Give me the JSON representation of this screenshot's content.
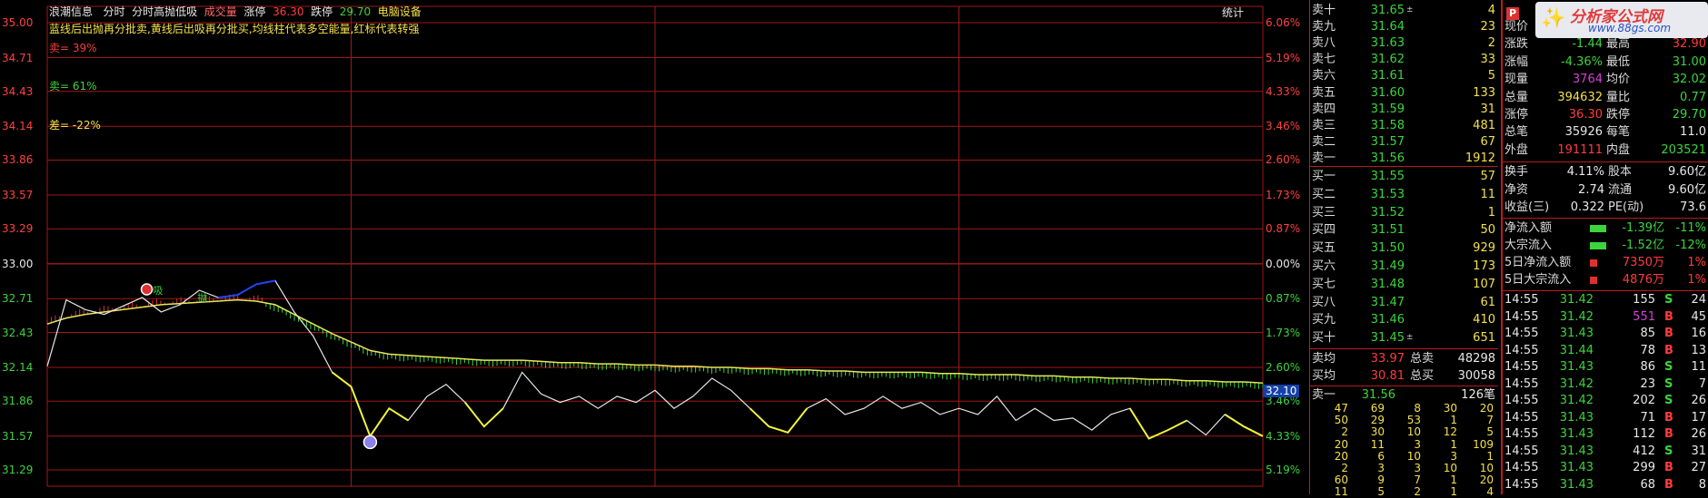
{
  "header": {
    "items": [
      "浪潮信息",
      "分时",
      "分时高抛低吸",
      "成交量",
      "涨停",
      "36.30",
      "跌停",
      "29.70",
      "电脑设备"
    ],
    "desc": "蓝线后出抛再分批卖,黄线后出吸再分批买,均线柱代表多空能量,红标代表转强",
    "sell_pct": "卖= 39%",
    "buy_pct": "卖= 61%",
    "diff_pct": "差= -22%",
    "stats_btn": "统计"
  },
  "price_axis": [
    "35.00",
    "34.71",
    "34.43",
    "34.14",
    "33.86",
    "33.57",
    "33.29",
    "33.00",
    "32.71",
    "32.43",
    "32.14",
    "31.86",
    "31.57",
    "31.29"
  ],
  "pct_axis": [
    "6.06%",
    "5.19%",
    "4.33%",
    "3.46%",
    "2.60%",
    "1.73%",
    "0.87%",
    "0.00%",
    "0.87%",
    "1.73%",
    "2.60%",
    "3.46%",
    "4.33%",
    "5.19%"
  ],
  "current_price_tag": "32.10",
  "markers": {
    "sell": "抛",
    "buy": "吸"
  },
  "colors": {
    "grid": "#a01818",
    "price_line": "#e8e8e8",
    "avg_line": "#e6e65a",
    "vol_green": "#3cd43c",
    "vol_red": "#e03030",
    "blue_line": "#2244ff",
    "yellow_hl": "#f2f23a"
  },
  "chart_data": {
    "type": "line",
    "title": "",
    "ylim": [
      31.29,
      35.0
    ],
    "prev_close": 33.0,
    "series": [
      {
        "values": [
          32.15,
          32.7,
          32.62,
          32.58,
          32.65,
          32.72,
          32.6,
          32.66,
          32.78,
          32.72,
          32.74,
          32.83,
          32.86,
          32.6,
          32.4,
          32.1,
          31.98,
          31.57,
          31.8,
          31.7,
          31.9,
          32.0,
          31.85,
          31.65,
          31.8,
          32.1,
          31.92,
          31.85,
          31.9,
          31.8,
          31.9,
          31.85,
          31.95,
          31.8,
          31.9,
          32.05,
          31.95,
          31.8,
          31.65,
          31.6,
          31.8,
          31.88,
          31.75,
          31.8,
          31.9,
          31.8,
          31.85,
          31.75,
          31.8,
          31.75,
          31.9,
          31.7,
          31.8,
          31.7,
          31.72,
          31.62,
          31.75,
          31.8,
          31.55,
          31.62,
          31.7,
          31.58,
          31.75,
          31.65,
          31.57
        ]
      },
      {
        "values": [
          32.5,
          32.55,
          32.58,
          32.6,
          32.62,
          32.64,
          32.66,
          32.67,
          32.68,
          32.69,
          32.7,
          32.69,
          32.66,
          32.58,
          32.5,
          32.42,
          32.35,
          32.28,
          32.25,
          32.24,
          32.23,
          32.22,
          32.21,
          32.2,
          32.2,
          32.2,
          32.19,
          32.18,
          32.18,
          32.17,
          32.17,
          32.16,
          32.16,
          32.15,
          32.15,
          32.14,
          32.14,
          32.13,
          32.13,
          32.12,
          32.12,
          32.11,
          32.11,
          32.1,
          32.1,
          32.1,
          32.1,
          32.09,
          32.09,
          32.08,
          32.08,
          32.08,
          32.07,
          32.07,
          32.06,
          32.06,
          32.05,
          32.05,
          32.04,
          32.04,
          32.03,
          32.03,
          32.02,
          32.02,
          32.01
        ]
      }
    ]
  },
  "quote": {
    "sells": [
      {
        "label": "卖十",
        "price": "31.65",
        "vol": "4",
        "color": "green",
        "mark": "±"
      },
      {
        "label": "卖九",
        "price": "31.64",
        "vol": "23",
        "color": "green"
      },
      {
        "label": "卖八",
        "price": "31.63",
        "vol": "2",
        "color": "green"
      },
      {
        "label": "卖七",
        "price": "31.62",
        "vol": "33",
        "color": "green"
      },
      {
        "label": "卖六",
        "price": "31.61",
        "vol": "5",
        "color": "green"
      },
      {
        "label": "卖五",
        "price": "31.60",
        "vol": "133",
        "color": "green"
      },
      {
        "label": "卖四",
        "price": "31.59",
        "vol": "31",
        "color": "green"
      },
      {
        "label": "卖三",
        "price": "31.58",
        "vol": "481",
        "color": "green"
      },
      {
        "label": "卖二",
        "price": "31.57",
        "vol": "67",
        "color": "green"
      },
      {
        "label": "卖一",
        "price": "31.56",
        "vol": "1912",
        "color": "green"
      }
    ],
    "buys": [
      {
        "label": "买一",
        "price": "31.55",
        "vol": "57",
        "color": "green"
      },
      {
        "label": "买二",
        "price": "31.53",
        "vol": "11",
        "color": "green"
      },
      {
        "label": "买三",
        "price": "31.52",
        "vol": "1",
        "color": "green"
      },
      {
        "label": "买四",
        "price": "31.51",
        "vol": "50",
        "color": "green"
      },
      {
        "label": "买五",
        "price": "31.50",
        "vol": "929",
        "color": "green"
      },
      {
        "label": "买六",
        "price": "31.49",
        "vol": "173",
        "color": "green"
      },
      {
        "label": "买七",
        "price": "31.48",
        "vol": "107",
        "color": "green"
      },
      {
        "label": "买八",
        "price": "31.47",
        "vol": "61",
        "color": "green"
      },
      {
        "label": "买九",
        "price": "31.46",
        "vol": "410",
        "color": "green"
      },
      {
        "label": "买十",
        "price": "31.45",
        "vol": "651",
        "color": "green",
        "mark": "±"
      }
    ],
    "avg_sell": {
      "label": "卖均",
      "price": "33.97",
      "tlabel": "总卖",
      "total": "48298"
    },
    "avg_buy": {
      "label": "买均",
      "price": "30.81",
      "tlabel": "总买",
      "total": "30058"
    },
    "queue_head": {
      "label": "卖一",
      "price": "31.56",
      "count": "126笔"
    },
    "queue": [
      [
        "47",
        "69",
        "8",
        "30",
        "20"
      ],
      [
        "50",
        "29",
        "53",
        "1",
        "7"
      ],
      [
        "2",
        "30",
        "10",
        "12",
        "5"
      ],
      [
        "20",
        "11",
        "3",
        "1",
        "109"
      ],
      [
        "20",
        "6",
        "10",
        "3",
        "1"
      ],
      [
        "2",
        "3",
        "3",
        "10",
        "10"
      ],
      [
        "60",
        "9",
        "7",
        "1",
        "20"
      ],
      [
        "11",
        "5",
        "2",
        "1",
        "4"
      ]
    ]
  },
  "info": {
    "rows": [
      {
        "l1": "现价",
        "v1": "",
        "l2": "",
        "v2": ""
      },
      {
        "l1": "涨跌",
        "v1": "-1.44",
        "l2": "最高",
        "v2": "32.90",
        "c1": "green",
        "c2": "red"
      },
      {
        "l1": "涨幅",
        "v1": "-4.36%",
        "l2": "最低",
        "v2": "31.00",
        "c1": "green",
        "c2": "green"
      },
      {
        "l1": "现量",
        "v1": "3764",
        "l2": "均价",
        "v2": "32.02",
        "c1": "mag",
        "c2": "green"
      },
      {
        "l1": "总量",
        "v1": "394632",
        "l2": "量比",
        "v2": "0.77",
        "c1": "yellow",
        "c2": "green"
      },
      {
        "l1": "涨停",
        "v1": "36.30",
        "l2": "跌停",
        "v2": "29.70",
        "c1": "red",
        "c2": "green"
      },
      {
        "l1": "总笔",
        "v1": "35926",
        "l2": "每笔",
        "v2": "11.0",
        "c1": "white",
        "c2": "white"
      },
      {
        "l1": "外盘",
        "v1": "191111",
        "l2": "内盘",
        "v2": "203521",
        "c1": "red",
        "c2": "green"
      }
    ],
    "rows2": [
      {
        "l1": "换手",
        "v1": "4.11%",
        "l2": "股本",
        "v2": "9.60亿"
      },
      {
        "l1": "净资",
        "v1": "2.74",
        "l2": "流通",
        "v2": "9.60亿"
      },
      {
        "l1": "收益(三)",
        "v1": "0.322",
        "l2": "PE(动)",
        "v2": "73.6"
      }
    ],
    "flows": [
      {
        "label": "净流入额",
        "value": "-1.39亿",
        "pct": "-11%",
        "color": "green",
        "bar": "green"
      },
      {
        "label": "大宗流入",
        "value": "-1.52亿",
        "pct": "-12%",
        "color": "green",
        "bar": "green"
      },
      {
        "label": "5日净流入额",
        "value": "7350万",
        "pct": "1%",
        "color": "red",
        "bar": "red"
      },
      {
        "label": "5日大宗流入",
        "value": "4876万",
        "pct": "1%",
        "color": "red",
        "bar": "red"
      }
    ],
    "trades": [
      {
        "t": "14:55",
        "p": "31.42",
        "v": "155",
        "s": "S",
        "n": "24",
        "vc": "white"
      },
      {
        "t": "14:55",
        "p": "31.42",
        "v": "551",
        "s": "B",
        "n": "45",
        "vc": "mag"
      },
      {
        "t": "14:55",
        "p": "31.43",
        "v": "85",
        "s": "B",
        "n": "16",
        "vc": "white"
      },
      {
        "t": "14:55",
        "p": "31.44",
        "v": "78",
        "s": "B",
        "n": "13",
        "vc": "white"
      },
      {
        "t": "14:55",
        "p": "31.43",
        "v": "86",
        "s": "S",
        "n": "11",
        "vc": "white"
      },
      {
        "t": "14:55",
        "p": "31.42",
        "v": "23",
        "s": "S",
        "n": "7",
        "vc": "white"
      },
      {
        "t": "14:55",
        "p": "31.42",
        "v": "202",
        "s": "S",
        "n": "26",
        "vc": "white"
      },
      {
        "t": "14:55",
        "p": "31.43",
        "v": "71",
        "s": "B",
        "n": "17",
        "vc": "white"
      },
      {
        "t": "14:55",
        "p": "31.43",
        "v": "112",
        "s": "B",
        "n": "26",
        "vc": "white"
      },
      {
        "t": "14:55",
        "p": "31.43",
        "v": "412",
        "s": "S",
        "n": "31",
        "vc": "white"
      },
      {
        "t": "14:55",
        "p": "31.43",
        "v": "299",
        "s": "B",
        "n": "27",
        "vc": "white"
      },
      {
        "t": "14:55",
        "p": "31.43",
        "v": "68",
        "s": "B",
        "n": "8",
        "vc": "white"
      }
    ]
  },
  "logo": {
    "badge": "P",
    "title": "分析家公式网",
    "url": "www.88gs.com"
  }
}
